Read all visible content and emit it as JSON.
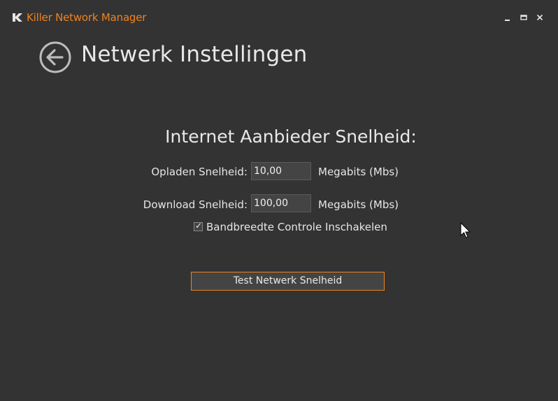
{
  "window": {
    "title": "Killer Network Manager",
    "accent_color": "#f0821e",
    "background_color": "#333333",
    "controls": {
      "minimize_icon": "minimize-icon",
      "maximize_icon": "maximize-icon",
      "close_icon": "close-icon",
      "minimize_glyph": "▁",
      "maximize_glyph": "▭",
      "close_glyph": "✕"
    }
  },
  "header": {
    "back_icon": "back-arrow-icon",
    "title": "Netwerk Instellingen"
  },
  "settings": {
    "heading": "Internet Aanbieder Snelheid:",
    "upload": {
      "label": "Opladen Snelheid:",
      "value": "10,00",
      "unit": "Megabits (Mbs)"
    },
    "download": {
      "label": "Download Snelheid:",
      "value": "100,00",
      "unit": "Megabits (Mbs)"
    },
    "bandwidth_control": {
      "label": "Bandbreedte Controle Inschakelen",
      "checked": true,
      "check_glyph": "✓"
    },
    "test_button_label": "Test Netwerk Snelheid"
  }
}
